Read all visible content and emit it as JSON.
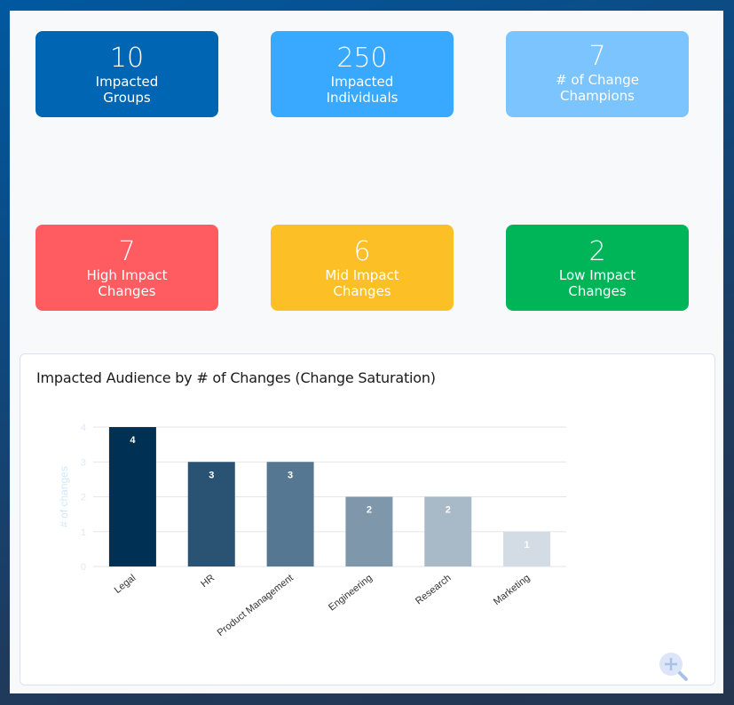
{
  "kpis": [
    {
      "value": "10",
      "label": "Impacted Groups",
      "color": "#0066b3"
    },
    {
      "value": "250",
      "label": "Impacted Individuals",
      "color": "#38a9ff"
    },
    {
      "value": "7",
      "label": "# of Change Champions",
      "color": "#7bc4fd"
    },
    {
      "value": "7",
      "label": "High Impact Changes",
      "color": "#ff5c61"
    },
    {
      "value": "6",
      "label": "Mid Impact Changes",
      "color": "#fcc026"
    },
    {
      "value": "2",
      "label": "Low Impact Changes",
      "color": "#00b557"
    }
  ],
  "chart_card": {
    "title": "Impacted Audience by # of Changes (Change Saturation)",
    "zoom_icon": "zoom-in-icon"
  },
  "chart_data": {
    "type": "bar",
    "title": "Impacted Audience by # of Changes (Change Saturation)",
    "xlabel": "",
    "ylabel": "# of changes",
    "categories": [
      "Legal",
      "HR",
      "Product Management",
      "Engineering",
      "Research",
      "Marketing"
    ],
    "values": [
      4,
      3,
      3,
      2,
      2,
      1
    ],
    "colors": [
      "#003154",
      "#2a5272",
      "#567791",
      "#7e97ab",
      "#a8b9c7",
      "#d3dce4"
    ],
    "ylim": [
      0,
      4
    ],
    "yticks": [
      0,
      1,
      2,
      3,
      4
    ],
    "grid": true,
    "data_labels": true,
    "legend": "none"
  }
}
